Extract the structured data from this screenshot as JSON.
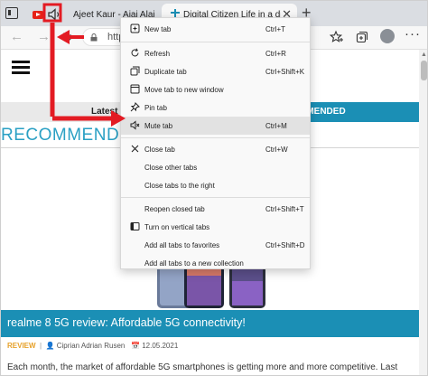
{
  "tabs": [
    {
      "title": "Ajeet Kaur - Ajai Alai - YouTube",
      "favicon": "youtube-icon",
      "audio": "speaker-icon"
    },
    {
      "title": "Digital Citizen Life in a digital world",
      "favicon": "digital-citizen-icon",
      "active": true
    }
  ],
  "tab_close_glyph": "✕",
  "new_tab_glyph": "+",
  "toolbar": {
    "address_text": "http",
    "icons": [
      "tab-actions-icon",
      "back-icon",
      "forward-icon",
      "refresh-icon",
      "lock-icon",
      "favorites-star-icon",
      "collections-icon",
      "profile-avatar-icon",
      "more-icon"
    ]
  },
  "glyphs": {
    "back": "←",
    "forward": "→",
    "reload": "↻",
    "more": "···"
  },
  "context_menu": {
    "items": [
      {
        "label": "New tab",
        "shortcut": "Ctrl+T",
        "icon": "new-tab-icon"
      },
      {
        "label": "Refresh",
        "shortcut": "Ctrl+R",
        "icon": "refresh-icon"
      },
      {
        "label": "Duplicate tab",
        "shortcut": "Ctrl+Shift+K",
        "icon": "duplicate-tab-icon"
      },
      {
        "label": "Move tab to new window",
        "shortcut": "",
        "icon": "move-window-icon"
      },
      {
        "label": "Pin tab",
        "shortcut": "",
        "icon": "pin-icon"
      },
      {
        "label": "Mute tab",
        "shortcut": "Ctrl+M",
        "icon": "mute-icon",
        "highlighted": true
      },
      {
        "label": "Close tab",
        "shortcut": "Ctrl+W",
        "icon": "close-icon"
      },
      {
        "label": "Close other tabs",
        "shortcut": "",
        "icon": ""
      },
      {
        "label": "Close tabs to the right",
        "shortcut": "",
        "icon": ""
      },
      {
        "label": "Reopen closed tab",
        "shortcut": "Ctrl+Shift+T",
        "icon": ""
      },
      {
        "label": "Turn on vertical tabs",
        "shortcut": "",
        "icon": "vertical-tabs-icon"
      },
      {
        "label": "Add all tabs to favorites",
        "shortcut": "Ctrl+Shift+D",
        "icon": ""
      },
      {
        "label": "Add all tabs to a new collection",
        "shortcut": "",
        "icon": ""
      }
    ]
  },
  "page": {
    "latest_label": "Latest",
    "recommended_tab_label": "MMENDED",
    "section_heading": "RECOMMENDED",
    "article_title": "realme 8 5G review: Affordable 5G connectivity!",
    "badge": "REVIEW",
    "author": "Ciprian Adrian Rusen",
    "date": "12.05.2021",
    "excerpt": "Each month, the market of affordable 5G smartphones is getting more and more competitive. Last"
  },
  "colors": {
    "accent": "#1b8fb5",
    "heading": "#2aa0c4",
    "badge": "#e6a12a",
    "annotation_red": "#e31b23"
  }
}
